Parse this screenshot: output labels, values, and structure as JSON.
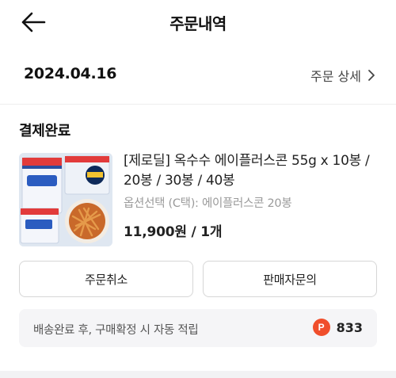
{
  "header": {
    "title": "주문내역",
    "back_icon": "arrow-left-icon"
  },
  "order": {
    "date": "2024.04.16",
    "detail_label": "주문 상세"
  },
  "status": "결제완료",
  "product": {
    "name": "[제로딜] 옥수수 에이플러스콘 55g x 10봉 / 20봉 / 30봉 / 40봉",
    "option": "옵션선택 (C택): 에이플러스콘 20봉",
    "price_qty": "11,900원 / 1개",
    "thumbnail_text": "에이플러스콘"
  },
  "actions": {
    "cancel_label": "주문취소",
    "inquiry_label": "판매자문의"
  },
  "reward": {
    "text": "배송완료 후, 구매확정 시 자동 적립",
    "badge": "P",
    "points": "833",
    "badge_color": "#f04e2b"
  }
}
